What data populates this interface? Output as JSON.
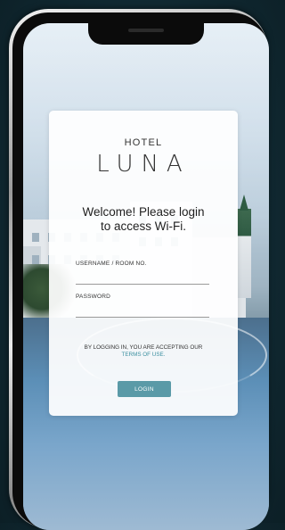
{
  "hotel": {
    "prefix": "HOTEL",
    "name": "LUNA"
  },
  "welcome": {
    "line1": "Welcome! Please login",
    "line2": "to access Wi-Fi."
  },
  "form": {
    "username_label": "USERNAME / ROOM NO.",
    "username_value": "",
    "password_label": "PASSWORD",
    "password_value": ""
  },
  "terms": {
    "prefix": "BY LOGGING IN, YOU ARE ACCEPTING OUR",
    "link": "TERMS OF USE."
  },
  "login_button": "LOGIN",
  "colors": {
    "accent": "#5a9aa7",
    "link": "#3b8fa0",
    "background": "#112a33"
  }
}
